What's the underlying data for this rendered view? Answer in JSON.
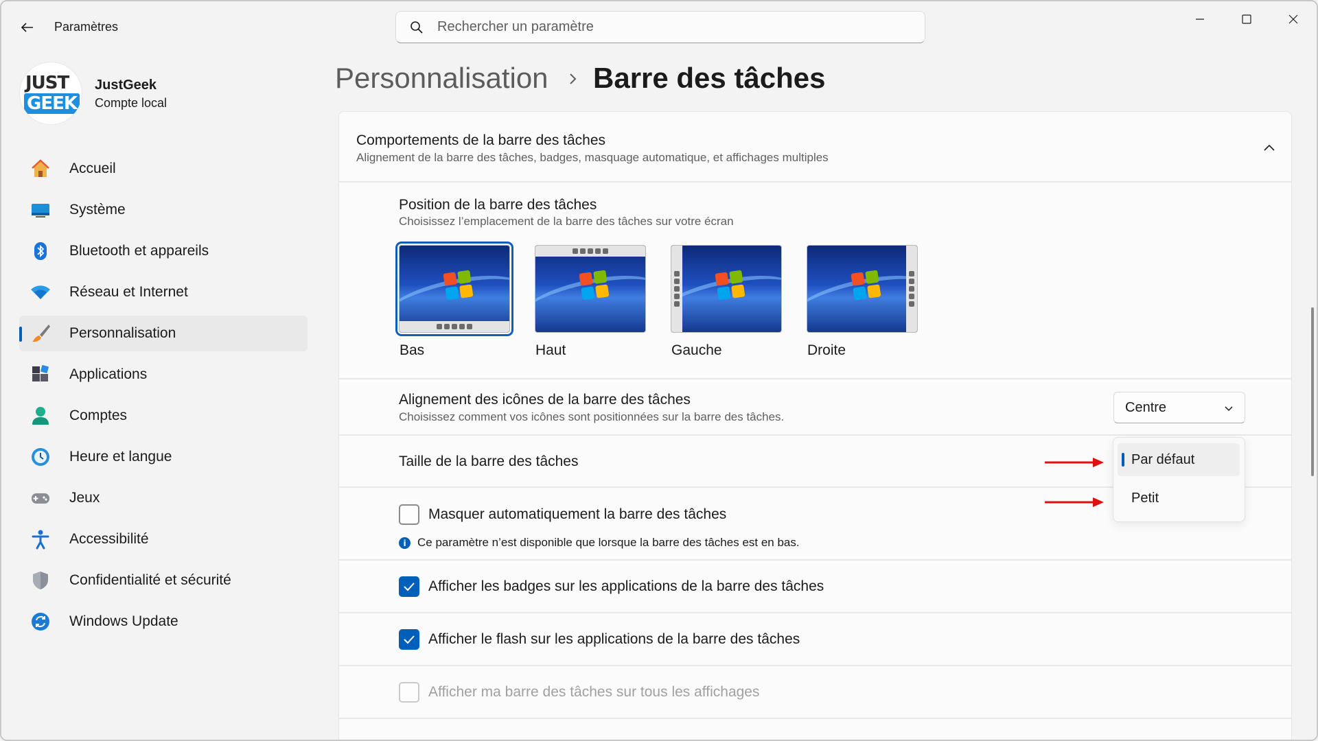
{
  "app": {
    "title": "Paramètres"
  },
  "search": {
    "placeholder": "Rechercher un paramètre"
  },
  "account": {
    "logo_line1": "JUST",
    "logo_line2": "GEEK",
    "name": "JustGeek",
    "type": "Compte local"
  },
  "nav": [
    {
      "label": "Accueil",
      "icon": "home-icon"
    },
    {
      "label": "Système",
      "icon": "system-icon"
    },
    {
      "label": "Bluetooth et appareils",
      "icon": "bluetooth-icon"
    },
    {
      "label": "Réseau et Internet",
      "icon": "wifi-icon"
    },
    {
      "label": "Personnalisation",
      "icon": "brush-icon",
      "active": true
    },
    {
      "label": "Applications",
      "icon": "apps-icon"
    },
    {
      "label": "Comptes",
      "icon": "account-icon"
    },
    {
      "label": "Heure et langue",
      "icon": "clock-icon"
    },
    {
      "label": "Jeux",
      "icon": "gamepad-icon"
    },
    {
      "label": "Accessibilité",
      "icon": "accessibility-icon"
    },
    {
      "label": "Confidentialité et sécurité",
      "icon": "shield-icon"
    },
    {
      "label": "Windows Update",
      "icon": "update-icon"
    }
  ],
  "breadcrumb": {
    "parent": "Personnalisation",
    "current": "Barre des tâches"
  },
  "section": {
    "title": "Comportements de la barre des tâches",
    "subtitle": "Alignement de la barre des tâches, badges, masquage automatique, et affichages multiples"
  },
  "position": {
    "title": "Position de la barre des tâches",
    "subtitle": "Choisissez l’emplacement de la barre des tâches sur votre écran",
    "options": [
      "Bas",
      "Haut",
      "Gauche",
      "Droite"
    ],
    "selected": "Bas"
  },
  "alignment": {
    "title": "Alignement des icônes de la barre des tâches",
    "subtitle": "Choisissez comment vos icônes sont positionnées sur la barre des tâches.",
    "value": "Centre"
  },
  "size": {
    "title": "Taille de la barre des tâches",
    "options": [
      "Par défaut",
      "Petit"
    ],
    "selected": "Par défaut"
  },
  "checkboxes": {
    "autohide": {
      "label": "Masquer automatiquement la barre des tâches",
      "checked": false
    },
    "autohide_info": "Ce paramètre n’est disponible que lorsque la barre des tâches est en bas.",
    "badges": {
      "label": "Afficher les badges sur les applications de la barre des tâches",
      "checked": true
    },
    "flash": {
      "label": "Afficher le flash sur les applications de la barre des tâches",
      "checked": true
    },
    "all_displays": {
      "label": "Afficher ma barre des tâches sur tous les affichages",
      "checked": false,
      "disabled": true
    }
  },
  "colors": {
    "accent": "#005fb8",
    "annotation_arrow": "#e01010"
  }
}
